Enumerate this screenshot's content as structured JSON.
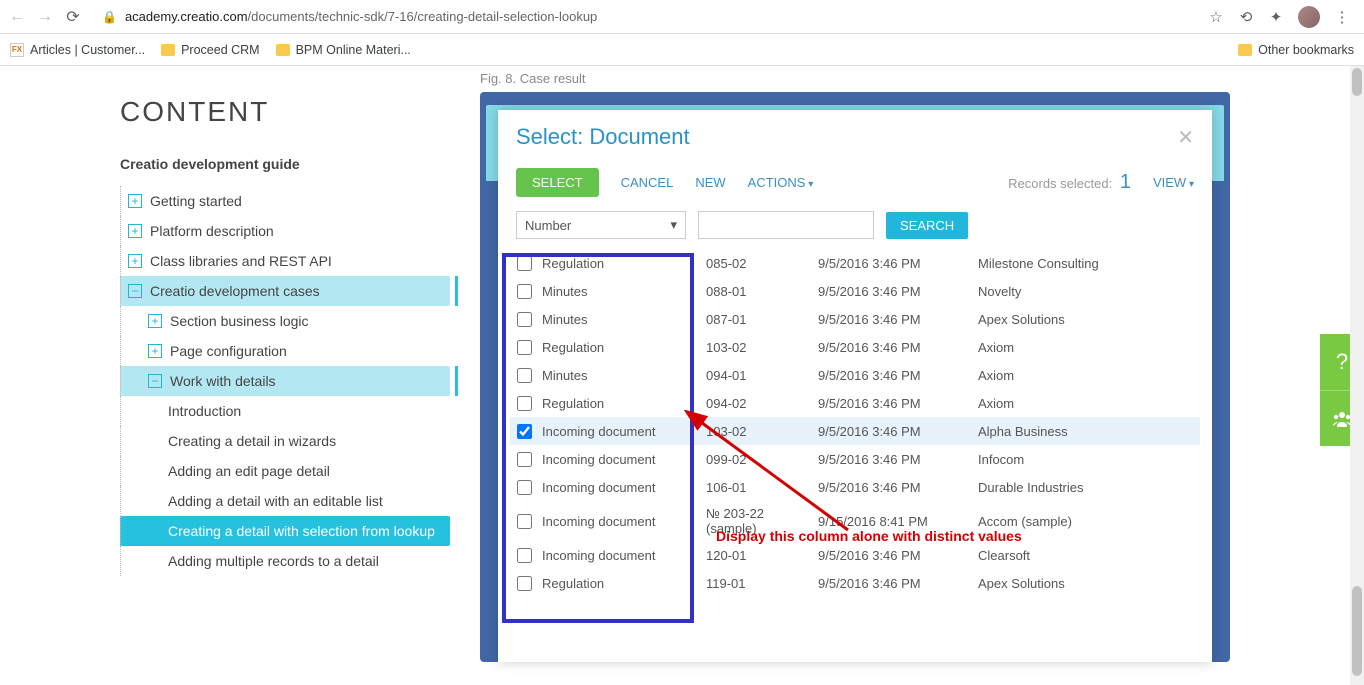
{
  "browser": {
    "url_host": "academy.creatio.com",
    "url_path": "/documents/technic-sdk/7-16/creating-detail-selection-lookup",
    "bookmarks": [
      {
        "label": "Articles | Customer...",
        "icon": "fx"
      },
      {
        "label": "Proceed CRM",
        "icon": "folder"
      },
      {
        "label": "BPM Online Materi...",
        "icon": "folder"
      }
    ],
    "other_bookmarks": "Other bookmarks"
  },
  "sidebar": {
    "heading": "CONTENT",
    "subheading": "Creatio development guide",
    "items": [
      {
        "label": "Getting started",
        "icon": "+",
        "level": 1
      },
      {
        "label": "Platform description",
        "icon": "+",
        "level": 1
      },
      {
        "label": "Class libraries and REST API",
        "icon": "+",
        "level": 1
      },
      {
        "label": "Creatio development cases",
        "icon": "−",
        "level": 1,
        "active": "outline"
      },
      {
        "label": "Section business logic",
        "icon": "+",
        "level": 2
      },
      {
        "label": "Page configuration",
        "icon": "+",
        "level": 2
      },
      {
        "label": "Work with details",
        "icon": "−",
        "level": 2,
        "active": "outline"
      },
      {
        "label": "Introduction",
        "level": 3
      },
      {
        "label": "Creating a detail in wizards",
        "level": 3
      },
      {
        "label": "Adding an edit page detail",
        "level": 3
      },
      {
        "label": "Adding a detail with an editable list",
        "level": 3
      },
      {
        "label": "Creating a detail with selection from lookup",
        "level": 3,
        "active": "teal"
      },
      {
        "label": "Adding multiple records to a detail",
        "level": 3
      }
    ]
  },
  "figure": {
    "caption": "Fig. 8. Case result",
    "dialog": {
      "title": "Select: Document",
      "buttons": {
        "select": "SELECT",
        "cancel": "CANCEL",
        "new": "NEW",
        "actions": "ACTIONS",
        "view": "VIEW",
        "search": "SEARCH"
      },
      "records_selected_label": "Records selected:",
      "records_selected_count": "1",
      "filter_column": "Number",
      "rows": [
        {
          "type": "Regulation",
          "num": "085-02",
          "date": "9/5/2016 3:46 PM",
          "acct": "Milestone Consulting",
          "checked": false
        },
        {
          "type": "Minutes",
          "num": "088-01",
          "date": "9/5/2016 3:46 PM",
          "acct": "Novelty",
          "checked": false
        },
        {
          "type": "Minutes",
          "num": "087-01",
          "date": "9/5/2016 3:46 PM",
          "acct": "Apex Solutions",
          "checked": false
        },
        {
          "type": "Regulation",
          "num": "103-02",
          "date": "9/5/2016 3:46 PM",
          "acct": "Axiom",
          "checked": false
        },
        {
          "type": "Minutes",
          "num": "094-01",
          "date": "9/5/2016 3:46 PM",
          "acct": "Axiom",
          "checked": false
        },
        {
          "type": "Regulation",
          "num": "094-02",
          "date": "9/5/2016 3:46 PM",
          "acct": "Axiom",
          "checked": false
        },
        {
          "type": "Incoming document",
          "num": "103-02",
          "date": "9/5/2016 3:46 PM",
          "acct": "Alpha Business",
          "checked": true
        },
        {
          "type": "Incoming document",
          "num": "099-02",
          "date": "9/5/2016 3:46 PM",
          "acct": "Infocom",
          "checked": false
        },
        {
          "type": "Incoming document",
          "num": "106-01",
          "date": "9/5/2016 3:46 PM",
          "acct": "Durable Industries",
          "checked": false
        },
        {
          "type": "Incoming document",
          "num": "№ 203-22 (sample)",
          "date": "9/15/2016 8:41 PM",
          "acct": "Accom (sample)",
          "checked": false
        },
        {
          "type": "Incoming document",
          "num": "120-01",
          "date": "9/5/2016 3:46 PM",
          "acct": "Clearsoft",
          "checked": false
        },
        {
          "type": "Regulation",
          "num": "119-01",
          "date": "9/5/2016 3:46 PM",
          "acct": "Apex Solutions",
          "checked": false
        }
      ]
    },
    "annotation": "Display this column alone with distinct values"
  }
}
